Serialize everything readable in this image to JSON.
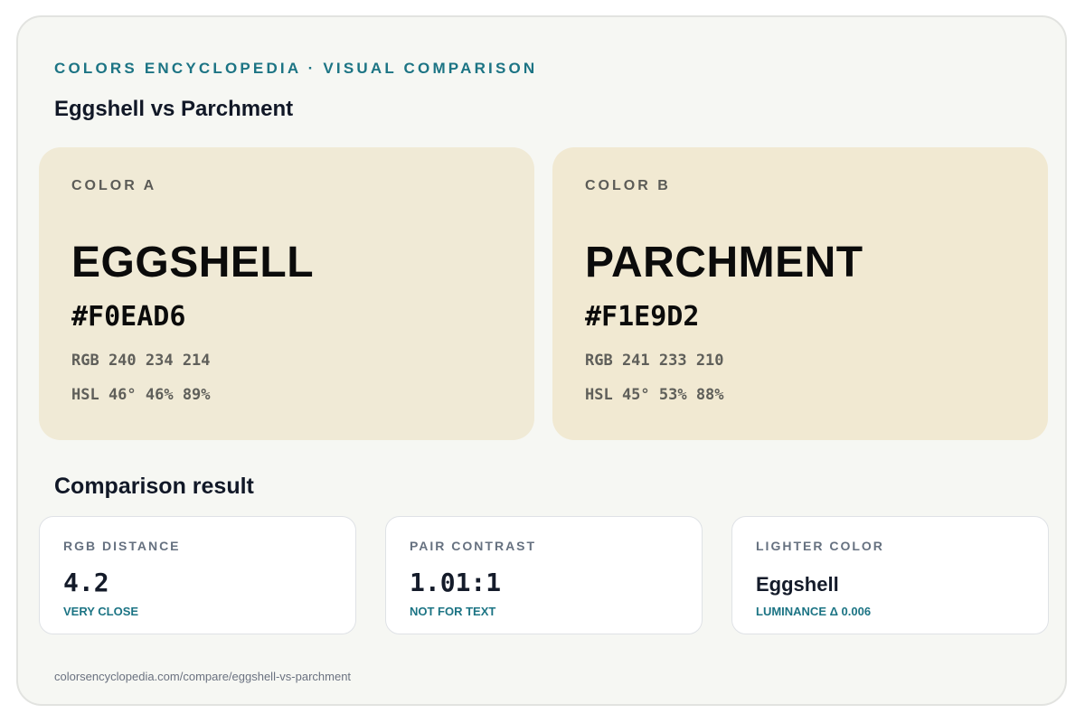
{
  "header": {
    "eyebrow": "COLORS ENCYCLOPEDIA · VISUAL COMPARISON",
    "title": "Eggshell vs Parchment"
  },
  "colors": [
    {
      "tag": "COLOR A",
      "name": "EGGSHELL",
      "hex": "#F0EAD6",
      "rgb": "RGB 240 234 214",
      "hsl": "HSL 46° 46% 89%",
      "swatch_color": "#F0EAD6"
    },
    {
      "tag": "COLOR B",
      "name": "PARCHMENT",
      "hex": "#F1E9D2",
      "rgb": "RGB 241 233 210",
      "hsl": "HSL 45° 53% 88%",
      "swatch_color": "#F1E9D2"
    }
  ],
  "comparison": {
    "title": "Comparison result",
    "cards": [
      {
        "label": "RGB DISTANCE",
        "value": "4.2",
        "note": "VERY CLOSE"
      },
      {
        "label": "PAIR CONTRAST",
        "value": "1.01:1",
        "note": "NOT FOR TEXT"
      },
      {
        "label": "LIGHTER COLOR",
        "value": "Eggshell",
        "note": "LUMINANCE Δ 0.006"
      }
    ]
  },
  "footer": {
    "url": "colorsencyclopedia.com/compare/eggshell-vs-parchment"
  },
  "theme": {
    "accent": "#1c7484",
    "background": "#f6f7f3",
    "card_background": "#ffffff"
  }
}
